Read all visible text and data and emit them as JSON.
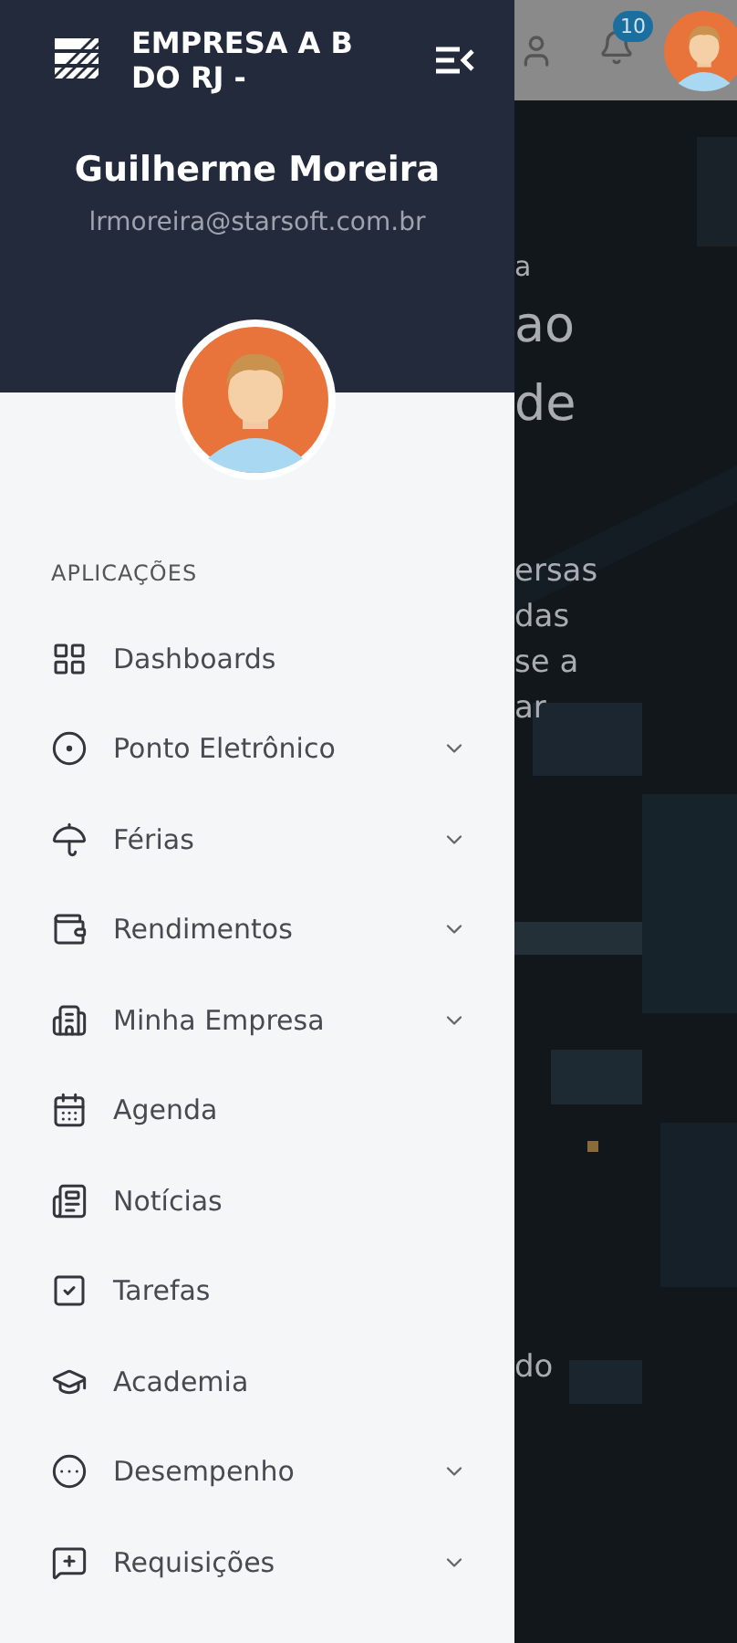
{
  "drawer": {
    "company": "EMPRESA A B DO RJ -",
    "user_name": "Guilherme Moreira",
    "user_email": "lrmoreira@starsoft.com.br",
    "section_label": "APLICAÇÕES",
    "items": [
      {
        "label": "Dashboards",
        "expandable": false
      },
      {
        "label": "Ponto Eletrônico",
        "expandable": true
      },
      {
        "label": "Férias",
        "expandable": true
      },
      {
        "label": "Rendimentos",
        "expandable": true
      },
      {
        "label": "Minha Empresa",
        "expandable": true
      },
      {
        "label": "Agenda",
        "expandable": false
      },
      {
        "label": "Notícias",
        "expandable": false
      },
      {
        "label": "Tarefas",
        "expandable": false
      },
      {
        "label": "Academia",
        "expandable": false
      },
      {
        "label": "Desempenho",
        "expandable": true
      },
      {
        "label": "Requisições",
        "expandable": true
      }
    ]
  },
  "top_bar": {
    "notification_count": "10"
  },
  "hero": {
    "blocks": [
      {
        "kind": "heading",
        "lines": [
          "a",
          "ao",
          "de"
        ]
      },
      {
        "kind": "body",
        "lines": [
          "ersas",
          "das",
          "se a",
          "ar"
        ]
      },
      {
        "kind": "footer",
        "lines": [
          "do"
        ]
      }
    ]
  }
}
